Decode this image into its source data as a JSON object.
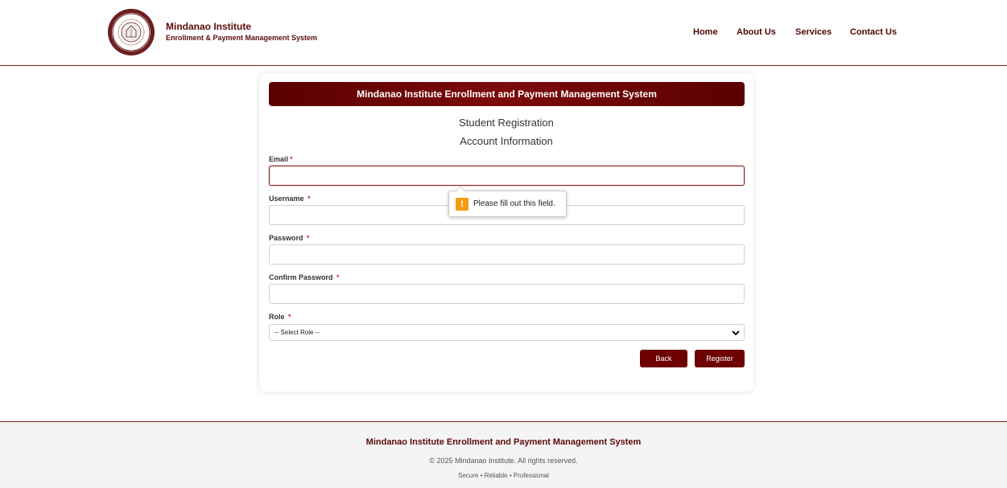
{
  "header": {
    "brand_title": "Mindanao Institute",
    "brand_subtitle": "Enrollment & Payment Management System",
    "nav": [
      "Home",
      "About Us",
      "Services",
      "Contact Us"
    ]
  },
  "form": {
    "banner": "Mindanao Institute Enrollment and Payment Management System",
    "heading": "Student Registration",
    "section": "Account Information",
    "fields": [
      {
        "label": "Email",
        "value": ""
      },
      {
        "label": "Username ",
        "value": ""
      },
      {
        "label": "Password ",
        "value": ""
      },
      {
        "label": "Confirm Password ",
        "value": ""
      }
    ],
    "role_label": "Role ",
    "role_selected": "-- Select Role --",
    "required_mark": "*",
    "back_label": "Back",
    "register_label": "Register"
  },
  "tooltip": {
    "icon": "!",
    "text": "Please fill out this field."
  },
  "footer": {
    "title": "Mindanao Institute Enrollment and Payment Management System",
    "copyright": "© 2025 Mindanao Institute. All rights reserved.",
    "tagline": "Secure • Reliable • Professional"
  },
  "colors": {
    "brand": "#5c0a0a",
    "button": "#6d0000",
    "warning": "#f39c12"
  },
  "icons": [
    "institute-seal-logo",
    "warning-icon",
    "chevron-down-icon"
  ]
}
